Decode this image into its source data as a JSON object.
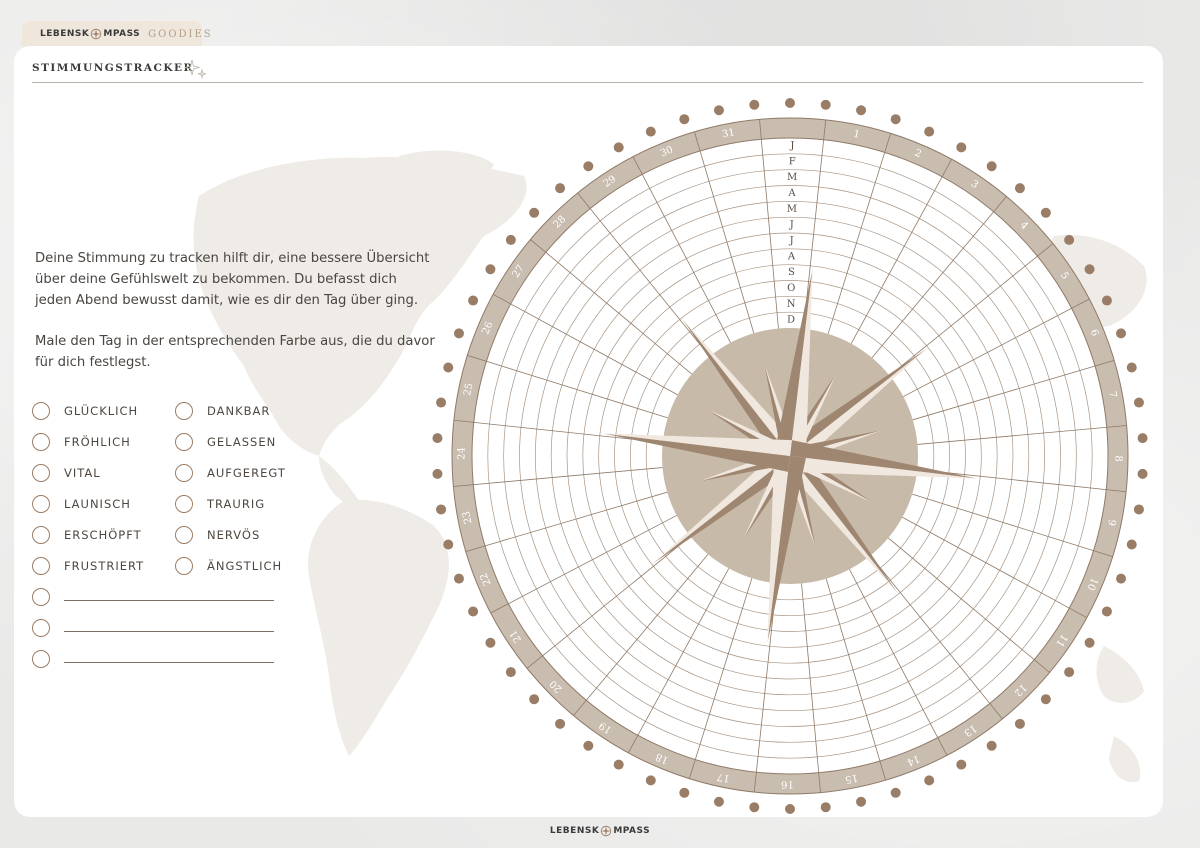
{
  "header": {
    "brand_left": "LEBENSK",
    "brand_right": "MPASS",
    "tab_label": "GOODIES",
    "logo_icon": "compass-rose-icon"
  },
  "page": {
    "title": "STIMMUNGSTRACKER"
  },
  "description": {
    "paragraph1": "Deine Stimmung zu tracken hilft dir, eine bessere Übersicht über deine Gefühlswelt zu bekommen. Du befasst dich jeden Abend bewusst damit, wie es dir den Tag über ging.",
    "paragraph2": "Male den Tag in der entsprechenden Farbe aus, die du davor für dich festlegst."
  },
  "moods": {
    "left": [
      "GLÜCKLICH",
      "FRÖHLICH",
      "VITAL",
      "LAUNISCH",
      "ERSCHÖPFT",
      "FRUSTRIERT"
    ],
    "right": [
      "DANKBAR",
      "GELASSEN",
      "AUFGEREGT",
      "TRAURIG",
      "NERVÖS",
      "ÄNGSTLICH"
    ],
    "blank_count": 3
  },
  "tracker": {
    "days": [
      "1",
      "2",
      "3",
      "4",
      "5",
      "6",
      "7",
      "8",
      "9",
      "10",
      "11",
      "12",
      "13",
      "14",
      "15",
      "16",
      "17",
      "18",
      "19",
      "20",
      "21",
      "22",
      "23",
      "24",
      "25",
      "26",
      "27",
      "28",
      "29",
      "30",
      "31"
    ],
    "months": [
      "J",
      "F",
      "M",
      "A",
      "M",
      "J",
      "J",
      "A",
      "S",
      "O",
      "N",
      "D"
    ],
    "dot_count": 62
  },
  "footer": {
    "brand_left": "LEBENSK",
    "brand_right": "MPASS"
  },
  "colors": {
    "accent": "#9c7c64",
    "ring": "#c9bdb0",
    "compass_disc": "#c8baa9",
    "star_dark": "#9f8671",
    "star_light": "#f0e8df",
    "map": "#efece7",
    "dot": "#9a7d66"
  }
}
